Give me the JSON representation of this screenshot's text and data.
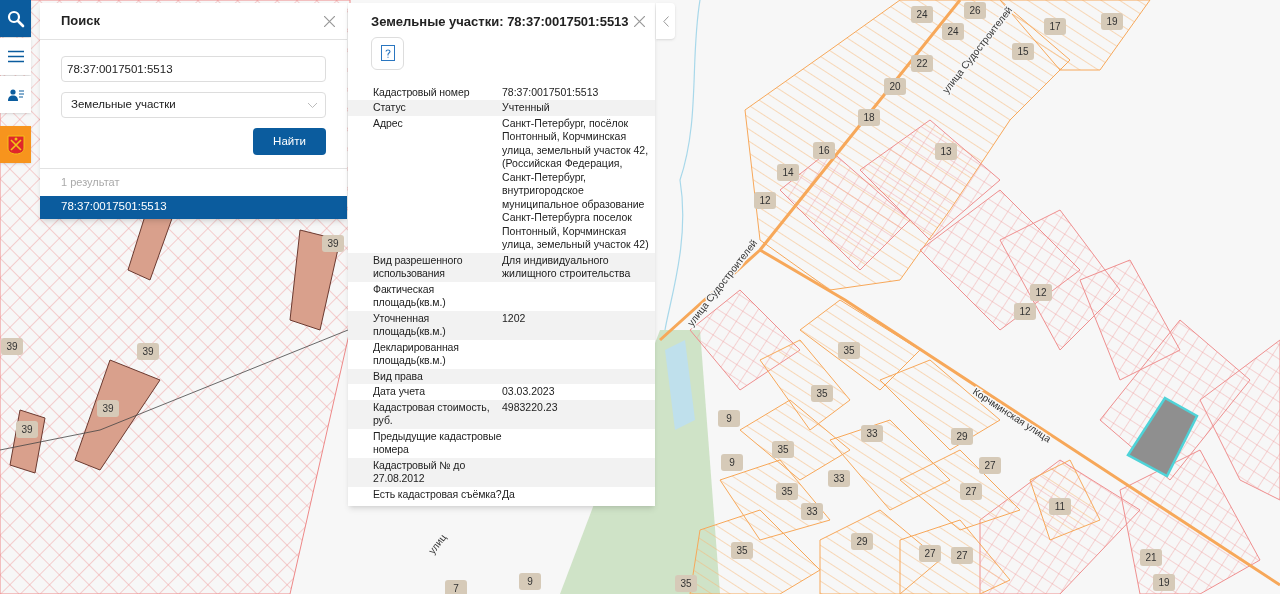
{
  "toolbar": [
    {
      "kind": "search",
      "selected": true
    },
    {
      "kind": "menu",
      "selected": false
    },
    {
      "kind": "users",
      "selected": false
    }
  ],
  "search_panel": {
    "title": "Поиск",
    "query": "78:37:0017501:5513",
    "type_select": "Земельные участки",
    "button": "Найти",
    "result_count": "1 результат",
    "results": [
      {
        "label": "78:37:0017501:5513",
        "selected": true
      }
    ]
  },
  "info_panel": {
    "title": "Земельные участки: 78:37:0017501:5513",
    "rows": [
      {
        "label": "Кадастровый номер",
        "value": "78:37:0017501:5513"
      },
      {
        "label": "Статус",
        "value": "Учтенный"
      },
      {
        "label": "Адрес",
        "value": "Санкт-Петербург, посёлок Понтонный, Корчминская улица, земельный участок 42, (Российская Федерация, Санкт-Петербург, внутригородское муниципальное образование Санкт-Петербурга поселок Понтонный, Корчминская улица, земельный участок 42)"
      },
      {
        "label": "Вид разрешенного использования",
        "value": "Для индивидуального жилищного строительства"
      },
      {
        "label": "Фактическая площадь(кв.м.)"
      },
      {
        "label": "Уточненная площадь(кв.м.)",
        "value": "1202"
      },
      {
        "label": "Декларированная площадь(кв.м.)"
      },
      {
        "label": "Вид права"
      },
      {
        "label": "Дата учета",
        "value": "03.03.2023"
      },
      {
        "label": "Кадастровая стоимость, руб.",
        "value": "4983220.23"
      },
      {
        "label": "Предыдущие кадастровые номера"
      },
      {
        "label": "Кадастровый № до 27.08.2012"
      },
      {
        "label": "Есть кадастровая съёмка?",
        "value": "Да"
      }
    ]
  },
  "map_labels": [
    {
      "kind": "street",
      "text": "улица Судостроителей"
    },
    {
      "kind": "street",
      "text": "улица Судостроителей"
    },
    {
      "kind": "street",
      "text": "Корчминская улица"
    },
    {
      "kind": "street",
      "text": "улиц"
    },
    {
      "kind": "house",
      "text": "24"
    },
    {
      "kind": "house",
      "text": "26"
    },
    {
      "kind": "house",
      "text": "24"
    },
    {
      "kind": "house",
      "text": "17"
    },
    {
      "kind": "house",
      "text": "19"
    },
    {
      "kind": "house",
      "text": "15"
    },
    {
      "kind": "house",
      "text": "22"
    },
    {
      "kind": "house",
      "text": "20"
    },
    {
      "kind": "house",
      "text": "18"
    },
    {
      "kind": "house",
      "text": "16"
    },
    {
      "kind": "house",
      "text": "13"
    },
    {
      "kind": "house",
      "text": "14"
    },
    {
      "kind": "house",
      "text": "12"
    },
    {
      "kind": "house",
      "text": "12"
    },
    {
      "kind": "house",
      "text": "12"
    },
    {
      "kind": "house",
      "text": "35"
    },
    {
      "kind": "house",
      "text": "35"
    },
    {
      "kind": "house",
      "text": "9"
    },
    {
      "kind": "house",
      "text": "9"
    },
    {
      "kind": "house",
      "text": "33"
    },
    {
      "kind": "house",
      "text": "29"
    },
    {
      "kind": "house",
      "text": "35"
    },
    {
      "kind": "house",
      "text": "27"
    },
    {
      "kind": "house",
      "text": "33"
    },
    {
      "kind": "house",
      "text": "35"
    },
    {
      "kind": "house",
      "text": "27"
    },
    {
      "kind": "house",
      "text": "11"
    },
    {
      "kind": "house",
      "text": "33"
    },
    {
      "kind": "house",
      "text": "29"
    },
    {
      "kind": "house",
      "text": "35"
    },
    {
      "kind": "house",
      "text": "27"
    },
    {
      "kind": "house",
      "text": "27"
    },
    {
      "kind": "house",
      "text": "21"
    },
    {
      "kind": "house",
      "text": "35"
    },
    {
      "kind": "house",
      "text": "19"
    },
    {
      "kind": "house",
      "text": "39"
    },
    {
      "kind": "house",
      "text": "39"
    },
    {
      "kind": "house",
      "text": "39"
    },
    {
      "kind": "house",
      "text": "39"
    },
    {
      "kind": "house",
      "text": "39"
    },
    {
      "kind": "house",
      "text": "7"
    },
    {
      "kind": "house",
      "text": "9"
    }
  ]
}
